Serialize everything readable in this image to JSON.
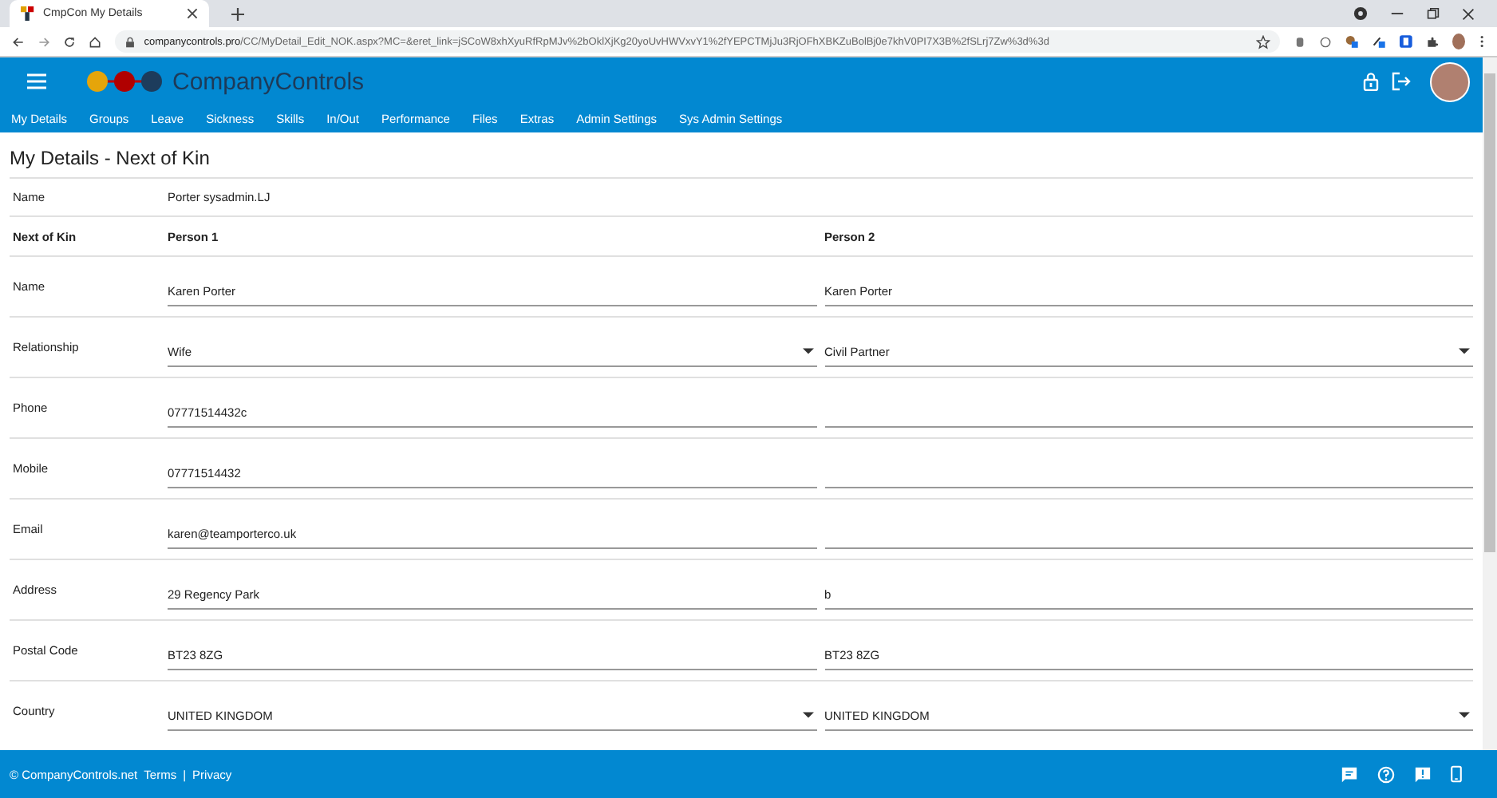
{
  "browser": {
    "tab_title": "CmpCon My Details",
    "url_host": "companycontrols.pro",
    "url_path": "/CC/MyDetail_Edit_NOK.aspx?MC=&eret_link=jSCoW8xhXyuRfRpMJv%2bOklXjKg20yoUvHWVxvY1%2fYEPCTMjJu3RjOFhXBKZuBolBj0e7khV0PI7X3B%2fSLrj7Zw%3d%3d"
  },
  "app": {
    "logo_text": "CompanyControls"
  },
  "nav": [
    {
      "label": "My Details"
    },
    {
      "label": "Groups"
    },
    {
      "label": "Leave"
    },
    {
      "label": "Sickness"
    },
    {
      "label": "Skills"
    },
    {
      "label": "In/Out"
    },
    {
      "label": "Performance"
    },
    {
      "label": "Files"
    },
    {
      "label": "Extras"
    },
    {
      "label": "Admin Settings"
    },
    {
      "label": "Sys Admin Settings"
    }
  ],
  "page_title": "My Details - Next of Kin",
  "name_row": {
    "label": "Name",
    "value": "Porter sysadmin.LJ"
  },
  "columns": {
    "label": "Next of Kin",
    "person_1": "Person 1",
    "person_2": "Person 2"
  },
  "rows": [
    {
      "label": "Name",
      "kind": "text",
      "person_1": "Karen Porter",
      "person_2": "Karen Porter"
    },
    {
      "label": "Relationship",
      "kind": "select",
      "person_1": "Wife",
      "person_2": "Civil Partner"
    },
    {
      "label": "Phone",
      "kind": "text",
      "person_1": "07771514432c"
    },
    {
      "label": "Mobile",
      "kind": "text",
      "person_1": "07771514432"
    },
    {
      "label": "Email",
      "kind": "text",
      "person_1": "karen@teamporterco.uk"
    },
    {
      "label": "Address",
      "kind": "text",
      "person_1": "29 Regency Park",
      "person_2": "b"
    },
    {
      "label": "Postal Code",
      "kind": "text",
      "person_1": "BT23 8ZG",
      "person_2": "BT23 8ZG"
    },
    {
      "label": "Country",
      "kind": "select",
      "person_1": "UNITED KINGDOM",
      "person_2": "UNITED KINGDOM"
    }
  ],
  "footer": {
    "copyright": "© CompanyControls.net",
    "links": [
      "Terms",
      "Privacy"
    ],
    "separator": "|"
  }
}
